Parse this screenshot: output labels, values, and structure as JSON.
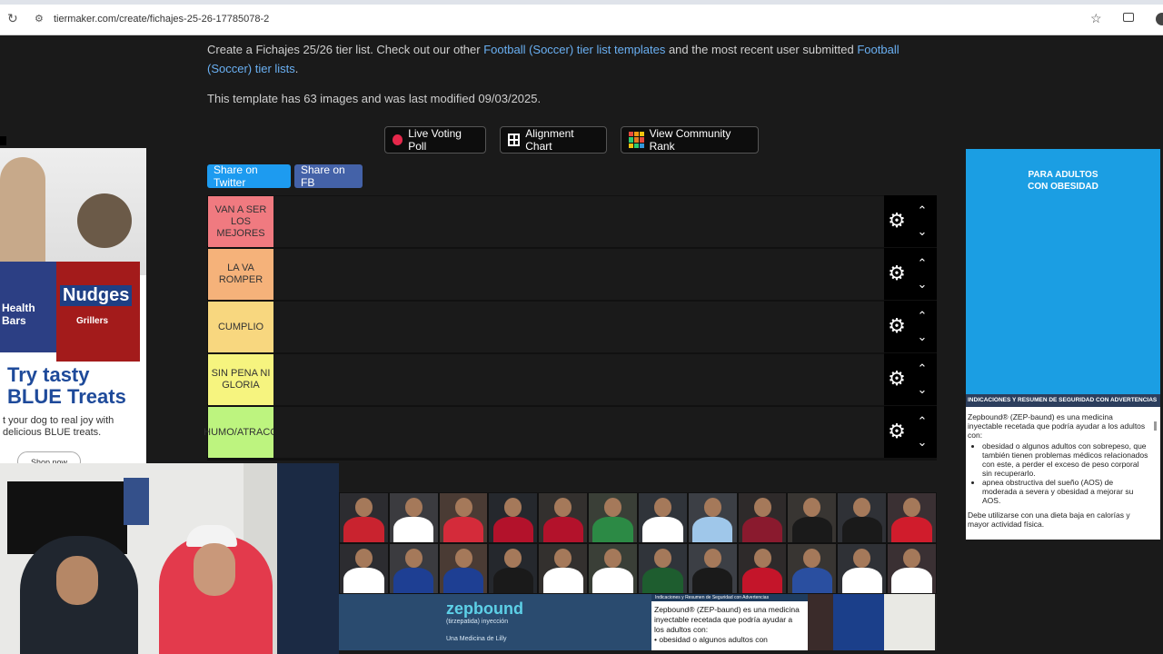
{
  "browser": {
    "url": "tiermaker.com/create/fichajes-25-26-17785078-2"
  },
  "intro": {
    "prefix": "Create a Fichajes 25/26 tier list. Check out our other ",
    "link1": "Football (Soccer) tier list templates",
    "middle": " and the most recent user submitted ",
    "link2": "Football (Soccer) tier lists",
    "suffix": "."
  },
  "meta_text": "This template has 63 images and was last modified 09/03/2025.",
  "actions": {
    "live_voting": "Live Voting Poll",
    "alignment": "Alignment Chart",
    "community_rank": "View Community Rank"
  },
  "share": {
    "twitter": "Share on Twitter",
    "fb": "Share on FB"
  },
  "tiers": [
    {
      "label": "VAN A SER LOS MEJORES",
      "color": "#f07a80"
    },
    {
      "label": "LA VA ROMPER",
      "color": "#f5b27a"
    },
    {
      "label": "CUMPLIO",
      "color": "#f8d77f"
    },
    {
      "label": "SIN PENA NI GLORIA",
      "color": "#f6f47f"
    },
    {
      "label": "HUMO/ATRACO",
      "color": "#bdf47f"
    }
  ],
  "ad_left": {
    "brand1": "Health Bars",
    "brand2": "Nudges",
    "brand2_sub": "Grillers",
    "headline_line1": "Try tasty",
    "headline_line2": "BLUE Treats",
    "sub_line1": "t your dog to real joy with",
    "sub_line2": "delicious BLUE treats.",
    "cta": "Shop now"
  },
  "ad_right": {
    "blue_line1": "PARA ADULTOS",
    "blue_line2": "CON OBESIDAD",
    "bar": "INDICACIONES Y RESUMEN DE SEGURIDAD CON ADVERTENCIAS",
    "intro": "Zepbound® (ZEP-baund) es una medicina inyectable recetada que podría ayudar a los adultos con:",
    "bullet1": "obesidad o algunos adultos con sobrepeso, que también tienen problemas médicos relacionados con este, a perder el exceso de peso corporal sin recuperarlo.",
    "bullet2": "apnea obstructiva del sueño (AOS) de moderada a severa y obesidad a mejorar su AOS.",
    "footer": "Debe utilizarse con una dieta baja en calorías y mayor actividad física."
  },
  "ad_bottom": {
    "logo": "zepbound",
    "logo_sub": "(tirzepatida) inyección",
    "lilly": "Una Medicina de Lilly",
    "isi_head": "Indicaciones y Resumen de Seguridad con Advertencias",
    "isi_text": "Zepbound® (ZEP-baund) es una medicina inyectable recetada que podría ayudar a los adultos con:",
    "isi_bullet": "• obesidad o algunos adultos con"
  },
  "pool_shirts": [
    "#c9232f",
    "#ffffff",
    "#d42b3a",
    "#b3122b",
    "#b3122b",
    "#2c8a45",
    "#ffffff",
    "#9fc7ea",
    "#8a1a2e",
    "#1a1a1a",
    "#1a1a1a",
    "#d01c2c",
    "#ffffff",
    "#1e3f93",
    "#1e3f93",
    "#1a1a1a",
    "#ffffff",
    "#ffffff",
    "#1e5d2f",
    "#1a1a1a",
    "#c4152a",
    "#2a4fa0",
    "#ffffff",
    "#ffffff"
  ],
  "icons": {
    "gear": "gear-icon",
    "up": "chevron-up-icon",
    "down": "chevron-down-icon"
  }
}
